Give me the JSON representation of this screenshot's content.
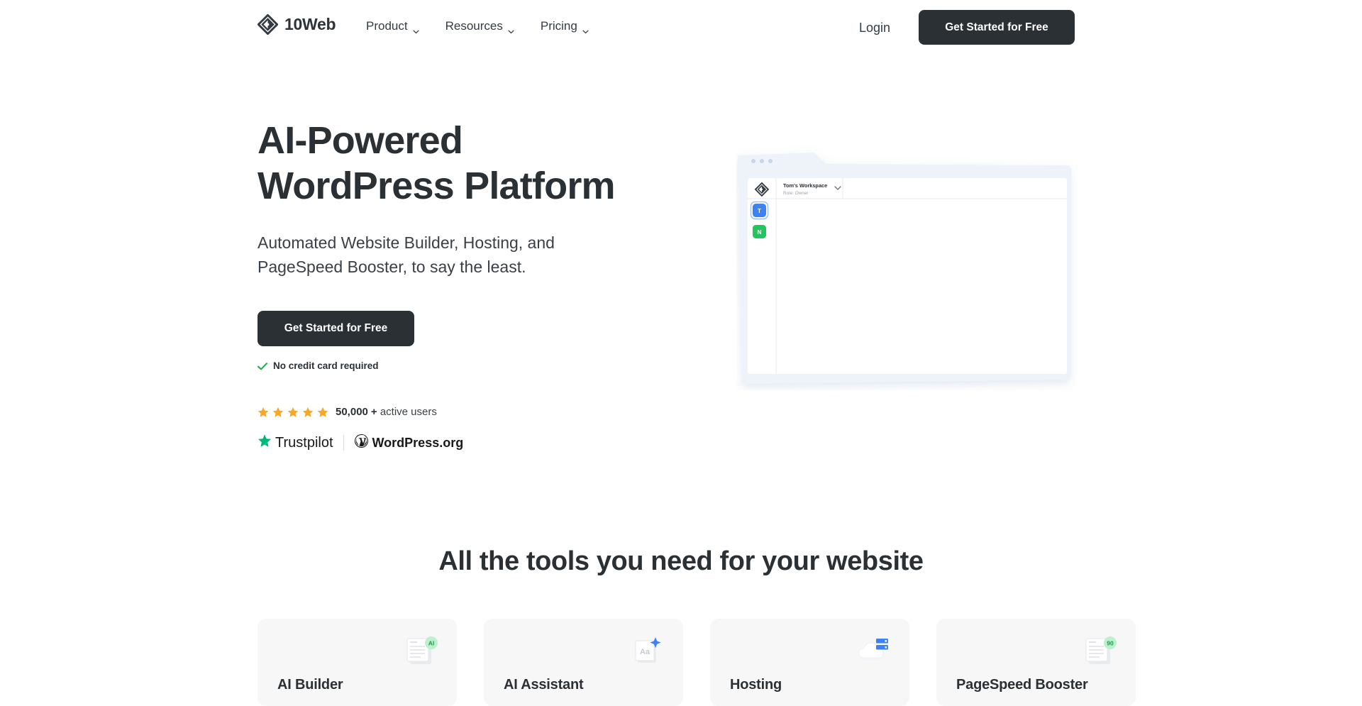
{
  "header": {
    "logo_text": "10Web",
    "logo_icon": "tenweb-diamond-logo",
    "nav": [
      {
        "label": "Product",
        "icon": "chevron-down-icon"
      },
      {
        "label": "Resources",
        "icon": "chevron-down-icon"
      },
      {
        "label": "Pricing",
        "icon": "chevron-down-icon"
      }
    ],
    "login_label": "Login",
    "cta_label": "Get Started for Free"
  },
  "hero": {
    "title": "AI-Powered\nWordPress Platform",
    "subtitle": "Automated Website Builder, Hosting, and\nPageSpeed Booster, to say the least.",
    "cta_label": "Get Started for Free",
    "no_credit_card": "No credit card required",
    "check_icon": "green-check-icon",
    "rating": {
      "stars": 5,
      "star_icon": "star-icon",
      "count": "50,000",
      "plus": "+",
      "suffix": "active users"
    },
    "badges": [
      {
        "name": "Trustpilot",
        "icon": "trustpilot-star-icon"
      },
      {
        "name": "WordPress.org",
        "icon": "wordpress-icon"
      }
    ]
  },
  "mockup": {
    "alt": "10Web dashboard browser window",
    "workspace_title": "Tom's Workspace",
    "workspace_role": "Role: Owner",
    "dropdown_icon": "chevron-down-icon",
    "logo_icon": "tenweb-diamond-logo",
    "sidebar_avatars": [
      {
        "letter": "T",
        "color": "#3b82f6"
      },
      {
        "letter": "N",
        "color": "#22c55e"
      }
    ],
    "window_dots": 3
  },
  "tools_section": {
    "title": "All the tools you need for your website",
    "cards": [
      {
        "title": "AI Builder",
        "icon": "document-ai-badge-icon",
        "badge": "AI",
        "badge_color": "#22c55e"
      },
      {
        "title": "AI Assistant",
        "icon": "text-sparkle-icon",
        "badge": "Aa",
        "badge_color": "#3b82f6"
      },
      {
        "title": "Hosting",
        "icon": "cloud-server-icon",
        "badge": "",
        "badge_color": "#3b82f6"
      },
      {
        "title": "PageSpeed Booster",
        "icon": "document-score-badge-icon",
        "badge": "90",
        "badge_color": "#22c55e"
      }
    ]
  },
  "colors": {
    "dark": "#2b3034",
    "text": "#333b44",
    "star": "#f9a825",
    "green": "#22c55e",
    "blue": "#3b82f6",
    "trustpilot_green": "#00b67a",
    "card_bg": "#f7f7f8"
  }
}
